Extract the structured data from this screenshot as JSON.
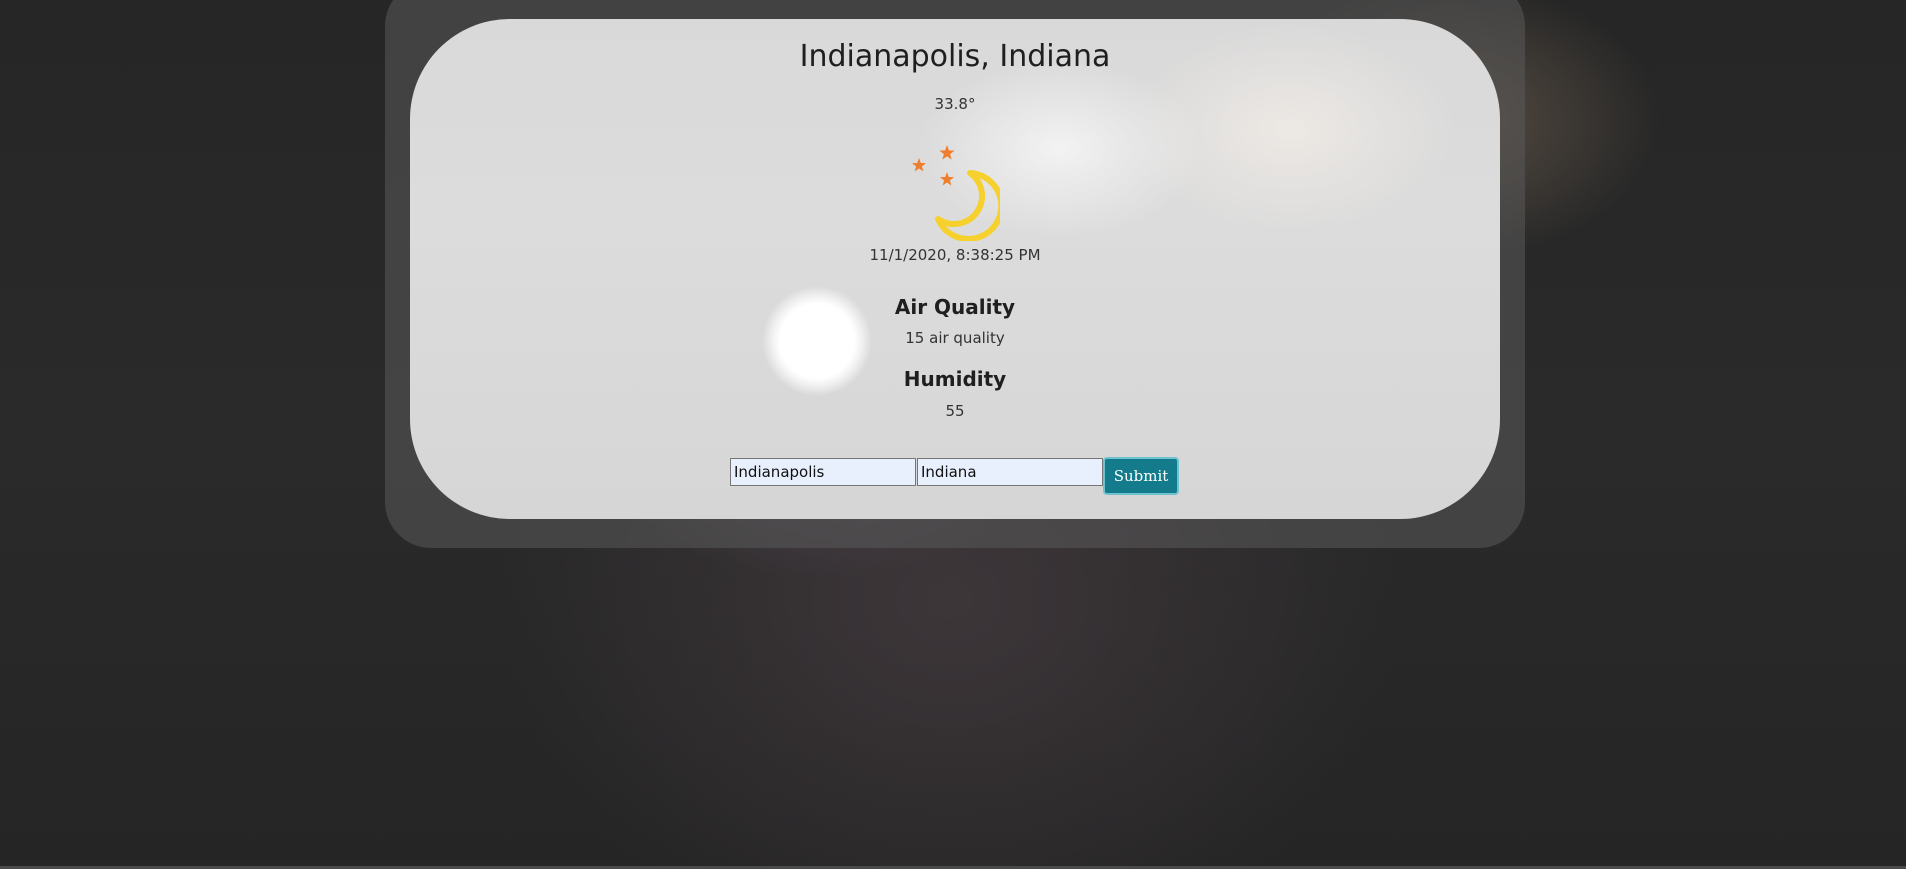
{
  "weather": {
    "location_title": "Indianapolis, Indiana",
    "temperature": "33.8°",
    "icon": "moon-stars-icon",
    "datetime": "11/1/2020, 8:38:25 PM"
  },
  "air_quality": {
    "heading": "Air Quality",
    "value": "15 air quality"
  },
  "humidity": {
    "heading": "Humidity",
    "value": "55"
  },
  "form": {
    "city_value": "Indianapolis",
    "state_value": "Indiana",
    "submit_label": "Submit"
  },
  "colors": {
    "submit_bg": "#137b8b",
    "moon": "#f6d12e",
    "stars": "#ef7e2c"
  }
}
